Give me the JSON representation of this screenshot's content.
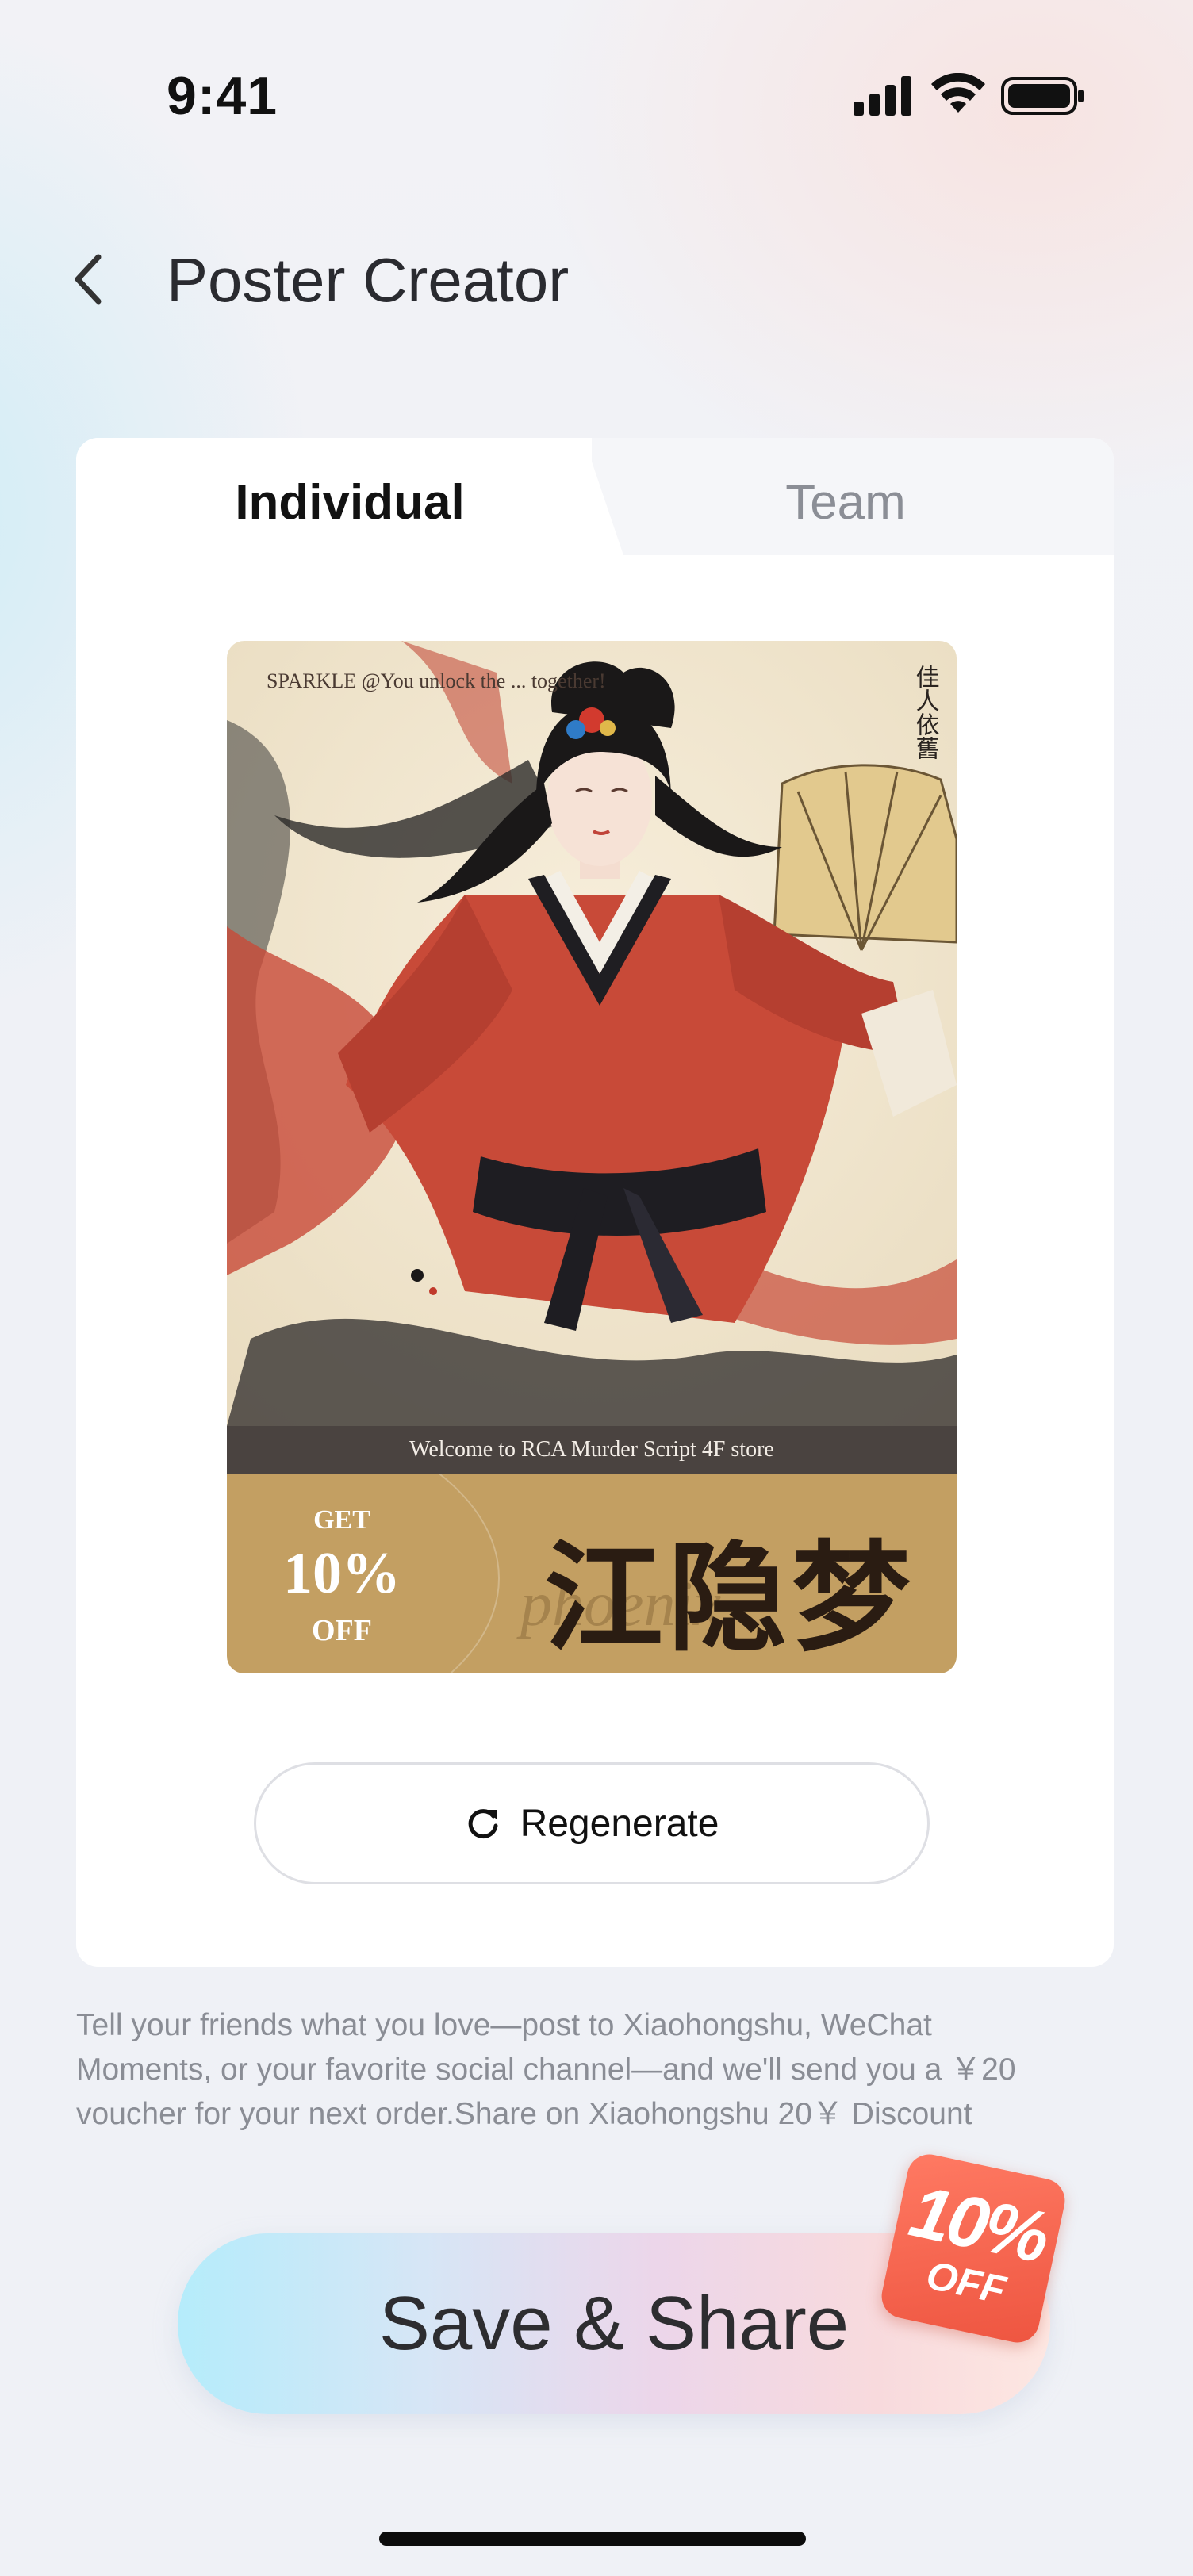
{
  "status_bar": {
    "time": "9:41",
    "signal_icon": "cellular-signal-icon",
    "wifi_icon": "wifi-icon",
    "battery_icon": "battery-full-icon"
  },
  "header": {
    "back_icon": "chevron-left-icon",
    "title": "Poster Creator"
  },
  "tabs": [
    {
      "label": "Individual",
      "active": true
    },
    {
      "label": "Team",
      "active": false
    }
  ],
  "poster": {
    "top_line": "SPARKLE @You unlock the ... together!",
    "vertical_text": "佳人依舊",
    "strip_text": "Welcome to RCA Murder Script 4F store",
    "coupon": {
      "get": "GET",
      "percent": "10%",
      "off": "OFF",
      "script_text": "phoenix",
      "cn_title": "江隐梦"
    },
    "colors": {
      "coupon_gold": "#c39f62",
      "strip": "#4a4340",
      "robe_red": "#c84a38"
    }
  },
  "regenerate": {
    "icon": "refresh-icon",
    "label": "Regenerate"
  },
  "promo": {
    "lines": [
      "Tell your friends what you love—post to Xiaohongshu, WeChat",
      "Moments, or your favorite social channel—and we'll send you a ￥20",
      "voucher for your next order.Share on Xiaohongshu 20￥ Discount"
    ]
  },
  "share_button": {
    "label": "Save & Share",
    "badge_percent": "10%",
    "badge_off": "OFF",
    "badge_color": "#ee5540"
  }
}
